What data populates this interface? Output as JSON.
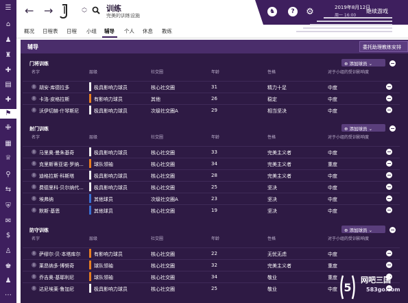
{
  "topbar": {
    "title": "训练",
    "subtitle": "完美的训练设施",
    "date": "2019年8月12日",
    "time": "周一 16:00",
    "continue_label": "继续游戏"
  },
  "tabs": [
    "概况",
    "日程表",
    "日程",
    "小组",
    "辅导",
    "个人",
    "休息",
    "教练"
  ],
  "active_tab": "辅导",
  "main": {
    "header": "辅导",
    "delegate_label": "委托助理教练安排"
  },
  "columns": [
    "名字",
    "层级",
    "社交圈",
    "年龄",
    "性格",
    "对于小组的受训影响度"
  ],
  "add_label": "添加球员",
  "sections": [
    {
      "title": "门将训练",
      "rows": [
        {
          "name": "胡安·库德拉多",
          "role": "极具影响力球员",
          "role_color": "#f0f0f0",
          "circle": "核心社交圈",
          "age": "31",
          "personality": "精力十足",
          "influence": "中度"
        },
        {
          "name": "卡洛·皮格拉斯",
          "role": "有影响力球员",
          "role_color": "#e67e22",
          "circle": "其他",
          "age": "26",
          "personality": "稳定",
          "influence": "中度"
        },
        {
          "name": "沃伊切赫·什琴斯尼",
          "role": "极具影响力球员",
          "role_color": "#f0f0f0",
          "circle": "次级社交圈A",
          "age": "29",
          "personality": "相当坚决",
          "influence": "中度"
        }
      ]
    },
    {
      "title": "射门训练",
      "rows": [
        {
          "name": "马里奥·曼朱基奇",
          "role": "极具影响力球员",
          "role_color": "#f0f0f0",
          "circle": "核心社交圈",
          "age": "33",
          "personality": "完美主义者",
          "influence": "中度"
        },
        {
          "name": "克里斯蒂亚诺·罗纳...",
          "role": "球队领袖",
          "role_color": "#e67e22",
          "circle": "核心社交圈",
          "age": "34",
          "personality": "完美主义者",
          "influence": "重度"
        },
        {
          "name": "迪格拉斯·科斯塔",
          "role": "极具影响力球员",
          "role_color": "#f0f0f0",
          "circle": "核心社交圈",
          "age": "28",
          "personality": "完美主义者",
          "influence": "中度"
        },
        {
          "name": "费德里科·贝尔纳代...",
          "role": "极具影响力球员",
          "role_color": "#f0f0f0",
          "circle": "核心社交圈",
          "age": "25",
          "personality": "坚决",
          "influence": "中度"
        },
        {
          "name": "埃弗纳",
          "role": "其他球员",
          "role_color": "#3a6fd0",
          "circle": "次级社交圈A",
          "age": "23",
          "personality": "坚决",
          "influence": "中度"
        },
        {
          "name": "默斯·基恩",
          "role": "其他球员",
          "role_color": "#3a6fd0",
          "circle": "核心社交圈",
          "age": "19",
          "personality": "坚决",
          "influence": "中度"
        }
      ]
    },
    {
      "title": "防守训练",
      "rows": [
        {
          "name": "萨缪尔·贝·本塔库尔",
          "role": "有影响力球员",
          "role_color": "#e67e22",
          "circle": "核心社交圈",
          "age": "22",
          "personality": "无忧无虑",
          "influence": "中度"
        },
        {
          "name": "莱昂纳多·博努奇",
          "role": "球队领袖",
          "role_color": "#e67e22",
          "circle": "核心社交圈",
          "age": "32",
          "personality": "完美主义者",
          "influence": "重度"
        },
        {
          "name": "乔吉奥·基耶利尼",
          "role": "球队领袖",
          "role_color": "#e67e22",
          "circle": "核心社交圈",
          "age": "34",
          "personality": "敬业",
          "influence": "重度"
        },
        {
          "name": "达尼埃莱·鲁加尼",
          "role": "极具影响力球员",
          "role_color": "#f0f0f0",
          "circle": "核心社交圈",
          "age": "25",
          "personality": "敬业",
          "influence": "中度"
        }
      ]
    }
  ],
  "watermark": {
    "brand": "网吧三国",
    "site": "583go.com"
  }
}
